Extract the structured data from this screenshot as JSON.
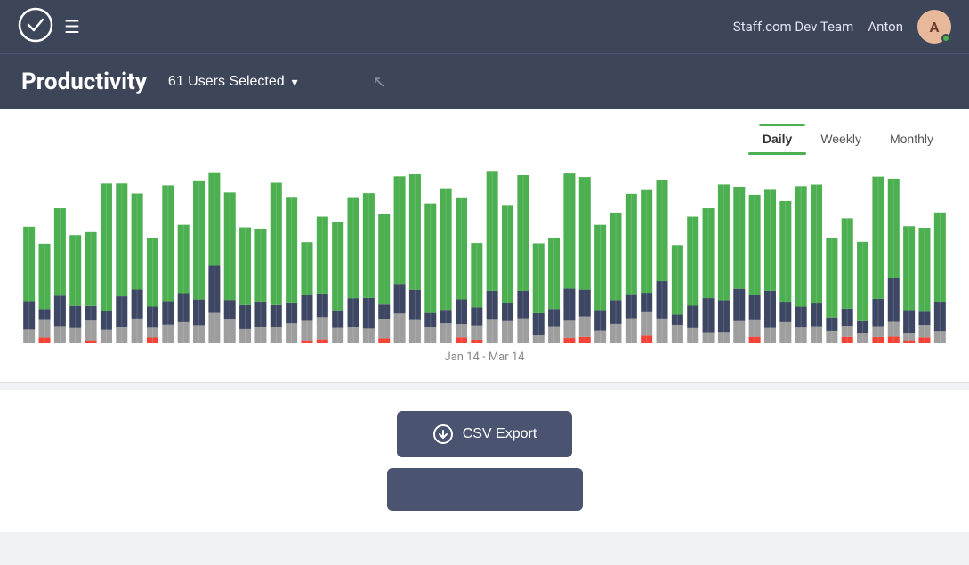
{
  "navbar": {
    "logo_alt": "Staff.com logo",
    "menu_icon": "☰",
    "team_name": "Staff.com Dev Team",
    "username": "Anton",
    "avatar_initials": "A",
    "avatar_color": "#e8b89a"
  },
  "page_header": {
    "title": "Productivity",
    "users_selected_label": "61 Users Selected",
    "chevron_icon": "▾"
  },
  "chart_section": {
    "period_tabs": [
      {
        "label": "Daily",
        "active": true
      },
      {
        "label": "Weekly",
        "active": false
      },
      {
        "label": "Monthly",
        "active": false
      }
    ],
    "date_range_label": "Jan 14 - Mar 14"
  },
  "export_section": {
    "csv_export_label": "CSV Export"
  },
  "colors": {
    "navbar_bg": "#3d4559",
    "green": "#4caf50",
    "dark_blue": "#3d4763",
    "gray": "#9e9e9e",
    "red": "#f44336",
    "white": "#ffffff"
  }
}
